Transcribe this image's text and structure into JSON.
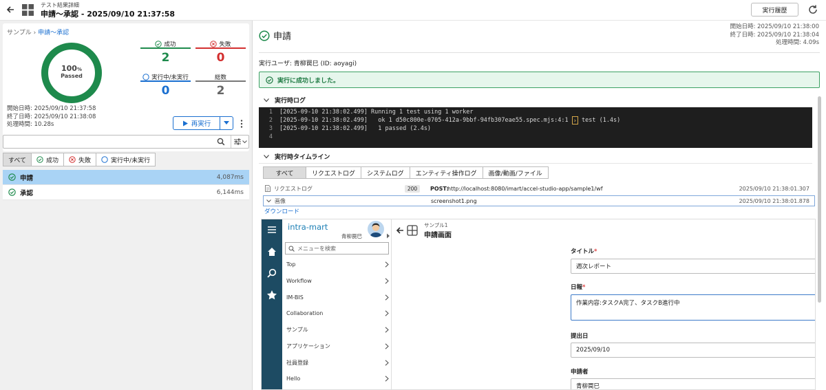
{
  "header": {
    "subtitle": "テスト結果詳細",
    "title": "申請～承認 - 2025/09/10 21:37:58",
    "history_button": "実行履歴"
  },
  "summary": {
    "breadcrumb_root": "サンプル",
    "breadcrumb_sep": "›",
    "breadcrumb_current": "申請～承認",
    "percent": "100",
    "percent_unit": "%",
    "percent_label": "Passed",
    "pass_ratio": 1.0,
    "success_label": "成功",
    "success_count": "2",
    "fail_label": "失敗",
    "fail_count": "0",
    "pending_label": "実行中/未実行",
    "pending_count": "0",
    "total_label": "総数",
    "total_count": "2",
    "start_time": "開始日時: 2025/09/10 21:37:58",
    "end_time": "終了日時: 2025/09/10 21:38:08",
    "duration": "処理時間: 10.28s",
    "rerun_button": "再実行"
  },
  "search": {
    "value": ""
  },
  "filters": [
    "すべて",
    "成功",
    "失敗",
    "実行中/未実行"
  ],
  "tests": [
    {
      "name": "申請",
      "time": "4,087ms"
    },
    {
      "name": "承認",
      "time": "6,144ms"
    }
  ],
  "detail": {
    "title": "申請",
    "start_time": "開始日時: 2025/09/10 21:38:00",
    "end_time": "終了日時: 2025/09/10 21:38:04",
    "duration": "処理時間: 4.09s",
    "user": "実行ユーザ: 青柳罠巳 (ID: aoyagi)",
    "success_message": "実行に成功しました。",
    "log_section": "実行時ログ",
    "log_lines": [
      {
        "num": "1",
        "text": "[2025-09-10 21:38:02.499] Running 1 test using 1 worker"
      },
      {
        "num": "2",
        "pre": "[2025-09-10 21:38:02.499]   ok 1 d50c800e-0705-412a-9bbf-94fb307eae55.spec.mjs:4:1 ",
        "mark": "›",
        "post": " test (1.4s)"
      },
      {
        "num": "3",
        "text": "[2025-09-10 21:38:02.499]   1 passed (2.4s)"
      },
      {
        "num": "4",
        "text": ""
      }
    ],
    "timeline_section": "実行時タイムライン",
    "timeline_tabs": [
      "すべて",
      "リクエストログ",
      "システムログ",
      "エンティティ操作ログ",
      "画像/動画/ファイル"
    ],
    "timeline_rows": [
      {
        "type": "リクエストログ",
        "status": "200",
        "method": "POST:",
        "detail": "http://localhost:8080/imart/accel-studio-app/sample1/wf",
        "time": "2025/09/10 21:38:01.307"
      },
      {
        "type": "画像",
        "detail": "screenshot1.png",
        "time": "2025/09/10 21:38:01.878"
      }
    ],
    "download_link": "ダウンロード"
  },
  "screenshot": {
    "logo": "intra-mart",
    "user": "青柳罠巳",
    "menu_search_placeholder": "メニューを検索",
    "menu_items": [
      "Top",
      "Workflow",
      "IM-BIS",
      "Collaboration",
      "サンプル",
      "アプリケーション",
      "社員登録",
      "Hello"
    ],
    "crumb": "サンプル1",
    "page_title": "申請画面",
    "fields": [
      {
        "label": "タイトル",
        "required": "*",
        "value": "週次レポート"
      },
      {
        "label": "日報",
        "required": "*",
        "value": "作業内容:タスクA完了、タスクB進行中"
      },
      {
        "label": "提出日",
        "required": "",
        "value": "2025/09/10"
      },
      {
        "label": "申請者",
        "required": "",
        "value": "青柳罠巳"
      }
    ]
  },
  "colors": {
    "success": "#1e8a4c",
    "fail": "#d32f2f",
    "pending": "#1a6fd0",
    "total": "#777777",
    "selected_row": "#a9d3f5",
    "rail": "#1d4b63"
  }
}
